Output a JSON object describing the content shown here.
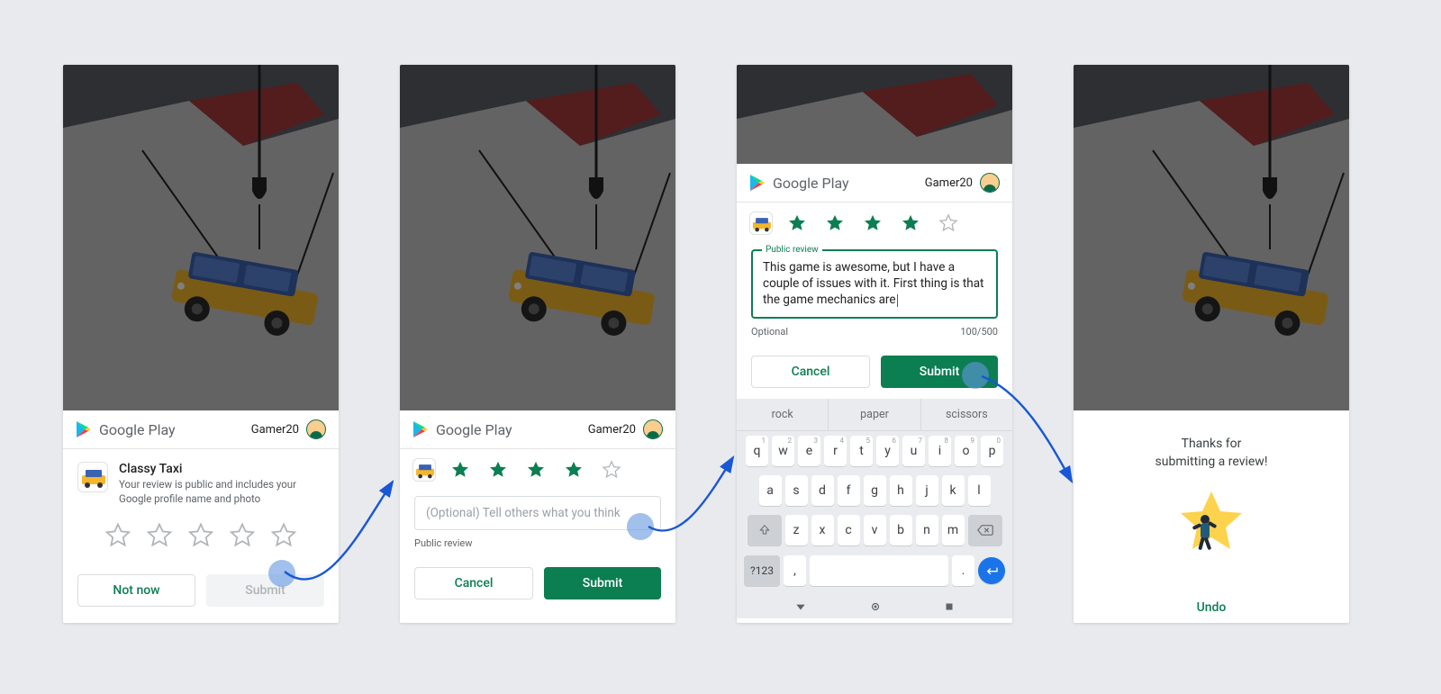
{
  "brand": "Google Play",
  "user": "Gamer20",
  "app": {
    "name": "Classy Taxi",
    "disclaimer": "Your review is public and includes your Google profile name and photo"
  },
  "panel1": {
    "rating": 0,
    "not_now": "Not now",
    "submit": "Submit"
  },
  "panel2": {
    "rating": 4,
    "placeholder": "(Optional) Tell others what you think",
    "caption": "Public review",
    "cancel": "Cancel",
    "submit": "Submit"
  },
  "panel3": {
    "rating": 4,
    "legend": "Public review",
    "review_text": "This game is awesome, but I have a couple of issues with it. First thing is that the game mechanics are",
    "optional": "Optional",
    "counter": "100/500",
    "cancel": "Cancel",
    "submit": "Submit",
    "suggestions": [
      "rock",
      "paper",
      "scissors"
    ],
    "row1": [
      {
        "k": "q",
        "n": "1"
      },
      {
        "k": "w",
        "n": "2"
      },
      {
        "k": "e",
        "n": "3"
      },
      {
        "k": "r",
        "n": "4"
      },
      {
        "k": "t",
        "n": "5"
      },
      {
        "k": "y",
        "n": "6"
      },
      {
        "k": "u",
        "n": "7"
      },
      {
        "k": "i",
        "n": "8"
      },
      {
        "k": "o",
        "n": "9"
      },
      {
        "k": "p",
        "n": "0"
      }
    ],
    "row2": [
      "a",
      "s",
      "d",
      "f",
      "g",
      "h",
      "j",
      "k",
      "l"
    ],
    "row3": [
      "z",
      "x",
      "c",
      "v",
      "b",
      "n",
      "m"
    ],
    "symkey": "?123",
    "comma": ",",
    "period": "."
  },
  "panel4": {
    "line1": "Thanks for",
    "line2": "submitting a review!",
    "undo": "Undo"
  }
}
